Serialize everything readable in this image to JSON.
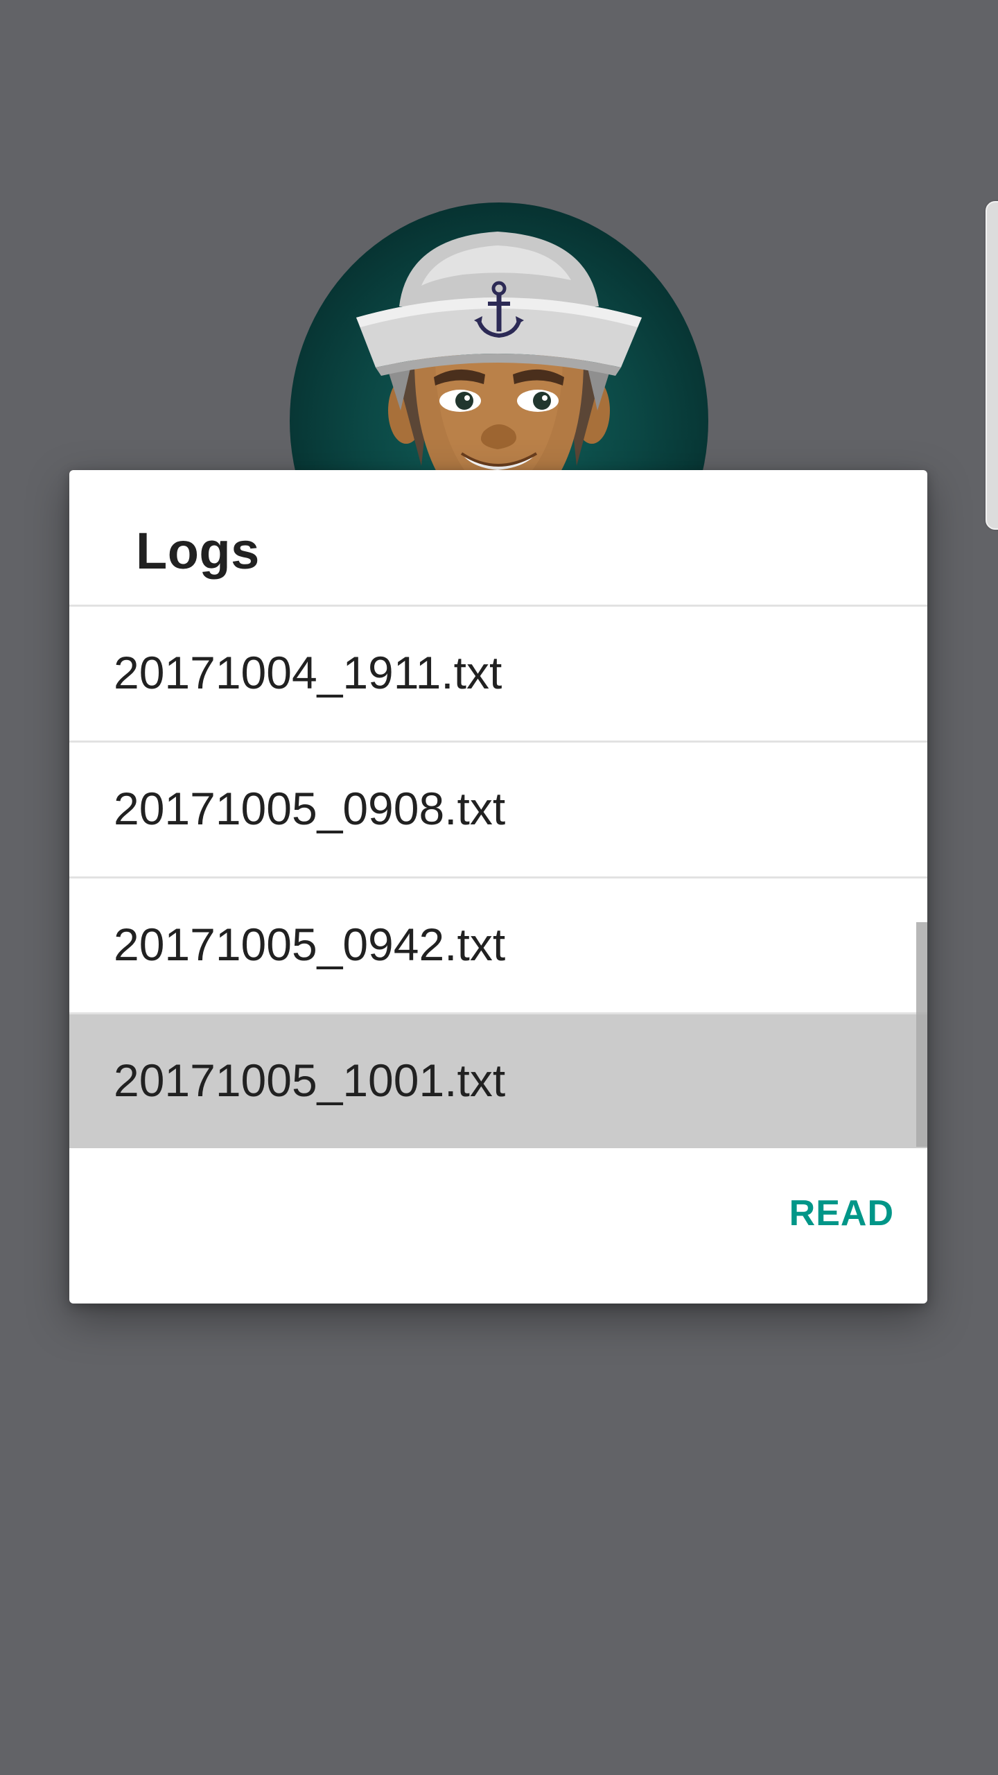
{
  "background": {
    "color": "#626367",
    "avatar_icon": "sailor-avatar-icon"
  },
  "dialog": {
    "title": "Logs",
    "items": [
      {
        "label": "20171004_1911.txt",
        "selected": false
      },
      {
        "label": "20171005_0908.txt",
        "selected": false
      },
      {
        "label": "20171005_0942.txt",
        "selected": false
      },
      {
        "label": "20171005_1001.txt",
        "selected": true
      }
    ],
    "read_button_label": "READ",
    "accent_color": "#009688",
    "selected_color": "#cbcbcb"
  }
}
